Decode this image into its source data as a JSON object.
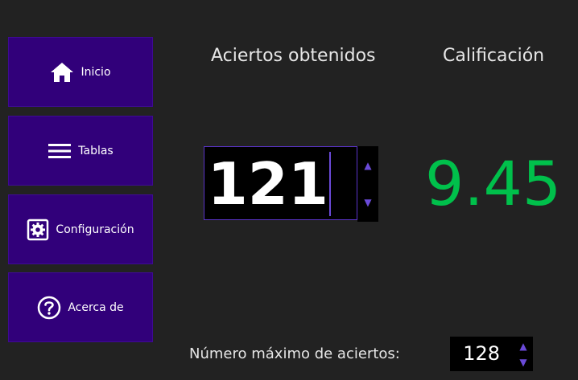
{
  "sidebar": {
    "items": [
      {
        "label": "Inicio",
        "icon": "home-icon"
      },
      {
        "label": "Tablas",
        "icon": "menu-lines-icon"
      },
      {
        "label": "Configuración",
        "icon": "settings-gear-icon"
      },
      {
        "label": "Acerca de",
        "icon": "question-circle-icon"
      }
    ]
  },
  "main": {
    "aciertos_heading": "Aciertos obtenidos",
    "calificacion_heading": "Calificación",
    "aciertos_value": "121",
    "calificacion_value": "9.45",
    "max_label": "Número máximo de aciertos:",
    "max_value": "128",
    "spin_up_glyph": "▲",
    "spin_down_glyph": "▼"
  },
  "colors": {
    "background": "#222222",
    "nav_button": "#31007a",
    "accent": "#6a4ad8",
    "grade_green": "#00c04b"
  }
}
